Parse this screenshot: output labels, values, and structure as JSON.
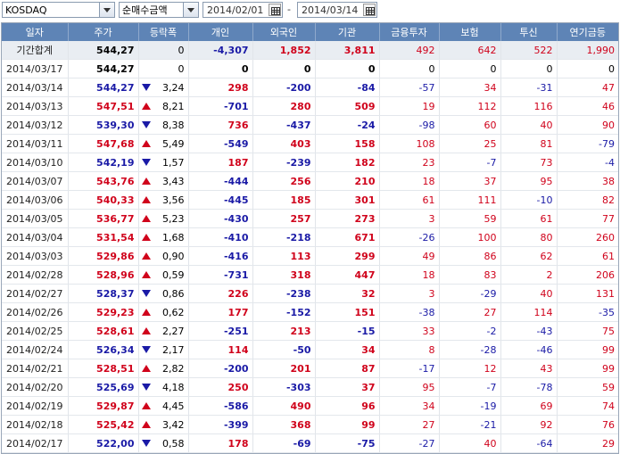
{
  "toolbar": {
    "market": "KOSDAQ",
    "metric": "순매수금액",
    "date_from": "2014/02/01",
    "separator": "-",
    "date_to": "2014/03/14"
  },
  "columns": [
    "일자",
    "주가",
    "등락폭",
    "개인",
    "외국인",
    "기관",
    "금융투자",
    "보험",
    "투신",
    "연기금등"
  ],
  "colors": {
    "up": "#d0021b",
    "down": "#1a1aa6",
    "header": "#5e84b6"
  },
  "rows": [
    {
      "date": "기간합계",
      "price": "544,27",
      "dir": "",
      "change": "0",
      "indiv": "-4,307",
      "foreign": "1,852",
      "inst": "3,811",
      "fin": "492",
      "ins": "642",
      "trust": "522",
      "pension": "1,990"
    },
    {
      "date": "2014/03/17",
      "price": "544,27",
      "dir": "",
      "change": "0",
      "indiv": "0",
      "foreign": "0",
      "inst": "0",
      "fin": "0",
      "ins": "0",
      "trust": "0",
      "pension": "0"
    },
    {
      "date": "2014/03/14",
      "price": "544,27",
      "dir": "down",
      "change": "3,24",
      "indiv": "298",
      "foreign": "-200",
      "inst": "-84",
      "fin": "-57",
      "ins": "34",
      "trust": "-31",
      "pension": "47"
    },
    {
      "date": "2014/03/13",
      "price": "547,51",
      "dir": "up",
      "change": "8,21",
      "indiv": "-701",
      "foreign": "280",
      "inst": "509",
      "fin": "19",
      "ins": "112",
      "trust": "116",
      "pension": "46"
    },
    {
      "date": "2014/03/12",
      "price": "539,30",
      "dir": "down",
      "change": "8,38",
      "indiv": "736",
      "foreign": "-437",
      "inst": "-24",
      "fin": "-98",
      "ins": "60",
      "trust": "40",
      "pension": "90"
    },
    {
      "date": "2014/03/11",
      "price": "547,68",
      "dir": "up",
      "change": "5,49",
      "indiv": "-549",
      "foreign": "403",
      "inst": "158",
      "fin": "108",
      "ins": "25",
      "trust": "81",
      "pension": "-79"
    },
    {
      "date": "2014/03/10",
      "price": "542,19",
      "dir": "down",
      "change": "1,57",
      "indiv": "187",
      "foreign": "-239",
      "inst": "182",
      "fin": "23",
      "ins": "-7",
      "trust": "73",
      "pension": "-4"
    },
    {
      "date": "2014/03/07",
      "price": "543,76",
      "dir": "up",
      "change": "3,43",
      "indiv": "-444",
      "foreign": "256",
      "inst": "210",
      "fin": "18",
      "ins": "37",
      "trust": "95",
      "pension": "38"
    },
    {
      "date": "2014/03/06",
      "price": "540,33",
      "dir": "up",
      "change": "3,56",
      "indiv": "-445",
      "foreign": "185",
      "inst": "301",
      "fin": "61",
      "ins": "111",
      "trust": "-10",
      "pension": "82"
    },
    {
      "date": "2014/03/05",
      "price": "536,77",
      "dir": "up",
      "change": "5,23",
      "indiv": "-430",
      "foreign": "257",
      "inst": "273",
      "fin": "3",
      "ins": "59",
      "trust": "61",
      "pension": "77"
    },
    {
      "date": "2014/03/04",
      "price": "531,54",
      "dir": "up",
      "change": "1,68",
      "indiv": "-410",
      "foreign": "-218",
      "inst": "671",
      "fin": "-26",
      "ins": "100",
      "trust": "80",
      "pension": "260"
    },
    {
      "date": "2014/03/03",
      "price": "529,86",
      "dir": "up",
      "change": "0,90",
      "indiv": "-416",
      "foreign": "113",
      "inst": "299",
      "fin": "49",
      "ins": "86",
      "trust": "62",
      "pension": "61"
    },
    {
      "date": "2014/02/28",
      "price": "528,96",
      "dir": "up",
      "change": "0,59",
      "indiv": "-731",
      "foreign": "318",
      "inst": "447",
      "fin": "18",
      "ins": "83",
      "trust": "2",
      "pension": "206"
    },
    {
      "date": "2014/02/27",
      "price": "528,37",
      "dir": "down",
      "change": "0,86",
      "indiv": "226",
      "foreign": "-238",
      "inst": "32",
      "fin": "3",
      "ins": "-29",
      "trust": "40",
      "pension": "131"
    },
    {
      "date": "2014/02/26",
      "price": "529,23",
      "dir": "up",
      "change": "0,62",
      "indiv": "177",
      "foreign": "-152",
      "inst": "151",
      "fin": "-38",
      "ins": "27",
      "trust": "114",
      "pension": "-35"
    },
    {
      "date": "2014/02/25",
      "price": "528,61",
      "dir": "up",
      "change": "2,27",
      "indiv": "-251",
      "foreign": "213",
      "inst": "-15",
      "fin": "33",
      "ins": "-2",
      "trust": "-43",
      "pension": "75"
    },
    {
      "date": "2014/02/24",
      "price": "526,34",
      "dir": "down",
      "change": "2,17",
      "indiv": "114",
      "foreign": "-50",
      "inst": "34",
      "fin": "8",
      "ins": "-28",
      "trust": "-46",
      "pension": "99"
    },
    {
      "date": "2014/02/21",
      "price": "528,51",
      "dir": "up",
      "change": "2,82",
      "indiv": "-200",
      "foreign": "201",
      "inst": "87",
      "fin": "-17",
      "ins": "12",
      "trust": "43",
      "pension": "99"
    },
    {
      "date": "2014/02/20",
      "price": "525,69",
      "dir": "down",
      "change": "4,18",
      "indiv": "250",
      "foreign": "-303",
      "inst": "37",
      "fin": "95",
      "ins": "-7",
      "trust": "-78",
      "pension": "59"
    },
    {
      "date": "2014/02/19",
      "price": "529,87",
      "dir": "up",
      "change": "4,45",
      "indiv": "-586",
      "foreign": "490",
      "inst": "96",
      "fin": "34",
      "ins": "-19",
      "trust": "69",
      "pension": "74"
    },
    {
      "date": "2014/02/18",
      "price": "525,42",
      "dir": "up",
      "change": "3,42",
      "indiv": "-399",
      "foreign": "368",
      "inst": "99",
      "fin": "27",
      "ins": "-21",
      "trust": "92",
      "pension": "76"
    },
    {
      "date": "2014/02/17",
      "price": "522,00",
      "dir": "down",
      "change": "0,58",
      "indiv": "178",
      "foreign": "-69",
      "inst": "-75",
      "fin": "-27",
      "ins": "40",
      "trust": "-64",
      "pension": "29"
    }
  ]
}
